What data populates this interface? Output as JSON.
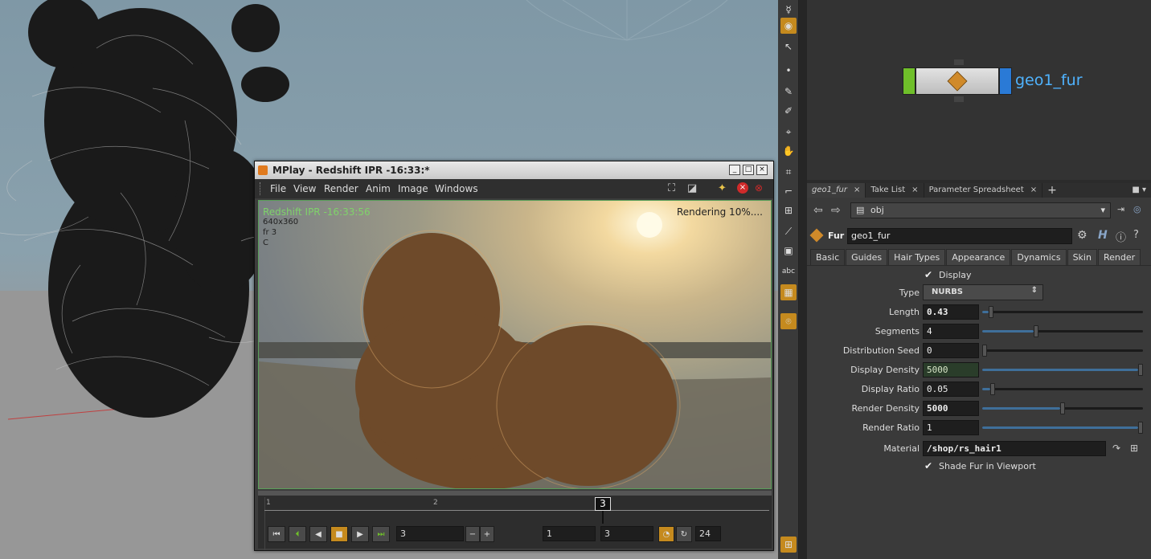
{
  "network": {
    "node_name": "geo1_fur"
  },
  "param_tabs": [
    {
      "label": "geo1_fur"
    },
    {
      "label": "Take List"
    },
    {
      "label": "Parameter Spreadsheet"
    }
  ],
  "path": {
    "value": "obj"
  },
  "node": {
    "type": "Fur",
    "name": "geo1_fur"
  },
  "folder_tabs": [
    "Basic",
    "Guides",
    "Hair Types",
    "Appearance",
    "Dynamics",
    "Skin",
    "Render"
  ],
  "params": {
    "display_label": "Display",
    "type_label": "Type",
    "type_value": "NURBS",
    "length_label": "Length",
    "length_value": "0.43",
    "length_level": 0.04,
    "segments_label": "Segments",
    "segments_value": "4",
    "segments_level": 0.33,
    "seed_label": "Distribution Seed",
    "seed_value": "0",
    "seed_level": 0.0,
    "ddensity_label": "Display Density",
    "ddensity_value": "5000",
    "ddensity_level": 1.0,
    "dratio_label": "Display Ratio",
    "dratio_value": "0.05",
    "dratio_level": 0.05,
    "rdensity_label": "Render Density",
    "rdensity_value": "5000",
    "rdensity_level": 0.5,
    "rratio_label": "Render Ratio",
    "rratio_value": "1",
    "rratio_level": 1.0,
    "material_label": "Material",
    "material_value": "/shop/rs_hair1",
    "shade_label": "Shade Fur in Viewport"
  },
  "mplay": {
    "title": "MPlay - Redshift IPR -16:33:*",
    "menu": [
      "File",
      "View",
      "Render",
      "Anim",
      "Image",
      "Windows"
    ],
    "overlay_title": "Redshift IPR -16:33:56",
    "overlay_res": "640x360",
    "overlay_frame": "fr 3",
    "overlay_channel": "C",
    "status": "Rendering 10%....",
    "timeline": {
      "tick1": "1",
      "tick2": "2",
      "current": "3"
    },
    "frame_field": "3",
    "range_start": "1",
    "range_end": "3",
    "fps": "24"
  },
  "colors": {
    "accent": "#c58a1e",
    "node_name": "#4fb3ff",
    "status_green": "#7fd36a"
  }
}
